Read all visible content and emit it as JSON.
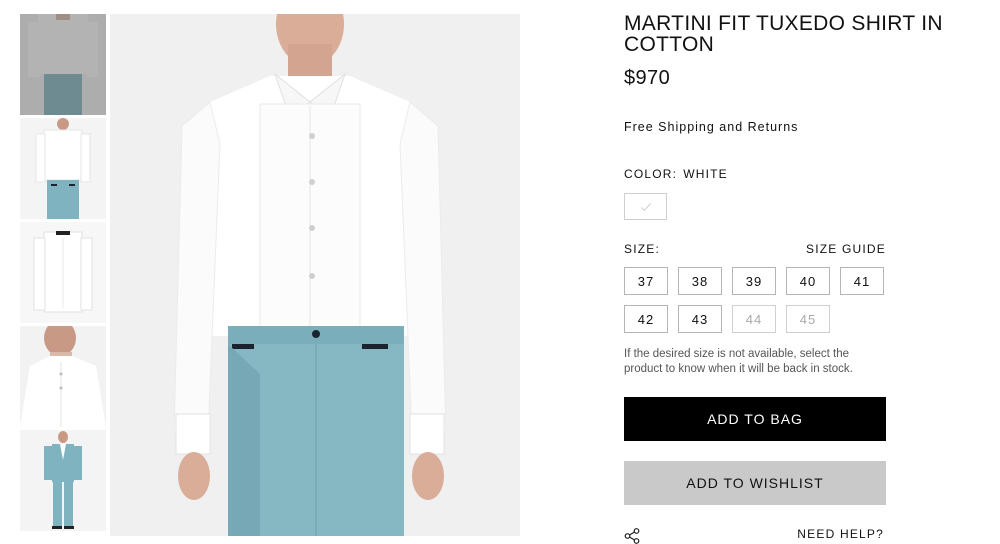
{
  "product": {
    "title": "MARTINI FIT TUXEDO SHIRT IN COTTON",
    "price": "$970",
    "shipping": "Free Shipping and Returns"
  },
  "color": {
    "label": "COLOR:",
    "value": "WHITE",
    "swatch_icon": "check-icon"
  },
  "size": {
    "label": "SIZE:",
    "guide": "SIZE GUIDE",
    "options": [
      {
        "label": "37",
        "available": true
      },
      {
        "label": "38",
        "available": true
      },
      {
        "label": "39",
        "available": true
      },
      {
        "label": "40",
        "available": true
      },
      {
        "label": "41",
        "available": true
      },
      {
        "label": "42",
        "available": true
      },
      {
        "label": "43",
        "available": true
      },
      {
        "label": "44",
        "available": false
      },
      {
        "label": "45",
        "available": false
      }
    ],
    "note": "If the desired size is not available, select the product to know when it will be back in stock."
  },
  "actions": {
    "add_to_bag": "ADD TO BAG",
    "add_to_wishlist": "ADD TO WISHLIST",
    "share_icon": "share-icon",
    "need_help": "NEED HELP?"
  },
  "gallery": {
    "thumbnails": [
      "front-shirt-with-pants",
      "front-shirt-full",
      "shirt-flat",
      "shirt-collar-closeup",
      "full-suit-look"
    ],
    "active_thumbnail": 0
  },
  "colors": {
    "accent": "#000000",
    "wishlist_bg": "#c9c9c9",
    "pants": "#7fb3bf",
    "shirt": "#ffffff"
  }
}
